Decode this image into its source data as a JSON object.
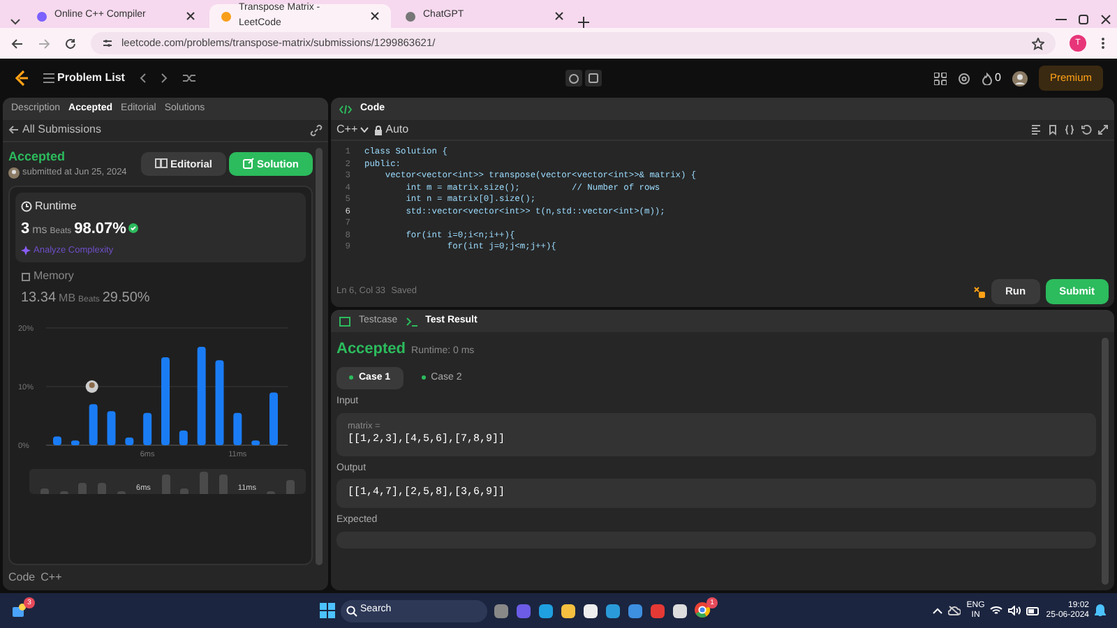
{
  "browser": {
    "tabs": [
      {
        "title": "Online C++ Compiler",
        "selected": false
      },
      {
        "title": "Transpose Matrix - LeetCode",
        "selected": true
      },
      {
        "title": "ChatGPT",
        "selected": false
      }
    ],
    "url": "leetcode.com/problems/transpose-matrix/submissions/1299863621/",
    "profile_initial": "T"
  },
  "header": {
    "problem_list": "Problem List",
    "streak": "0",
    "premium": "Premium"
  },
  "left_panel": {
    "tabs": [
      {
        "label": "Description",
        "selected": false
      },
      {
        "label": "Accepted",
        "selected": true
      },
      {
        "label": "Editorial",
        "selected": false
      },
      {
        "label": "Solutions",
        "selected": false
      }
    ],
    "back_link": "All Submissions",
    "status": "Accepted",
    "submitted": "submitted at Jun 25, 2024",
    "editorial_button": "Editorial",
    "solution_button": "Solution",
    "runtime": {
      "label": "Runtime",
      "value": "3",
      "unit": "ms",
      "beats_label": "Beats",
      "beats": "98.07%",
      "analyze": "Analyze Complexity"
    },
    "memory": {
      "label": "Memory",
      "value": "13.34",
      "unit": "MB",
      "beats_label": "Beats",
      "beats": "29.50%"
    },
    "chart_data": {
      "type": "bar",
      "x": [
        1,
        2,
        3,
        4,
        5,
        6,
        7,
        8,
        9,
        10,
        11,
        12,
        13
      ],
      "xlim": [
        1,
        13
      ],
      "series": [
        {
          "color": "#1a7cf5",
          "values": [
            1.5,
            0.8,
            7,
            5.8,
            1.3,
            5.5,
            15,
            2.5,
            16.8,
            14.5,
            5.5,
            0.8,
            9
          ]
        }
      ],
      "ylim": [
        0,
        20
      ],
      "yticks": [
        {
          "value": 0,
          "label": "0%"
        },
        {
          "value": 10,
          "label": "10%"
        },
        {
          "value": 20,
          "label": "20%"
        }
      ],
      "xticks": [
        {
          "value": 6,
          "label": "6ms"
        },
        {
          "value": 11,
          "label": "11ms"
        }
      ]
    },
    "navigator_labels": [
      "6ms",
      "11ms"
    ],
    "footer": [
      "Code",
      "C++"
    ]
  },
  "code_panel": {
    "title": "Code",
    "language": "C++",
    "mode": "Auto",
    "lines": [
      {
        "number": "1",
        "text": "class Solution {",
        "current": false
      },
      {
        "number": "2",
        "text": "public:",
        "current": false
      },
      {
        "number": "3",
        "text": "    vector<vector<int>> transpose(vector<vector<int>>& matrix) {",
        "current": false
      },
      {
        "number": "4",
        "text": "        int m = matrix.size();          // Number of rows",
        "current": false
      },
      {
        "number": "5",
        "text": "        int n = matrix[0].size();",
        "current": false
      },
      {
        "number": "6",
        "text": "        std::vector<vector<int>> t(n,std::vector<int>(m));",
        "current": true
      },
      {
        "number": "7",
        "current": false
      },
      {
        "number": "8",
        "text": "        for(int i=0;i<n;i++){",
        "current": false
      },
      {
        "number": "9",
        "text": "                for(int j=0;j<m;j++){",
        "current": false
      }
    ],
    "cursor": "Ln 6, Col 33",
    "save_state": "Saved",
    "run_button": "Run",
    "submit_button": "Submit"
  },
  "test_panel": {
    "tabs": [
      {
        "label": "Testcase",
        "selected": false
      },
      {
        "label": "Test Result",
        "selected": true
      }
    ],
    "result": "Accepted",
    "runtime": "Runtime: 0 ms",
    "cases": [
      {
        "label": "Case 1",
        "selected": true
      },
      {
        "label": "Case 2",
        "selected": false
      }
    ],
    "sections": [
      {
        "label": "Input",
        "param": "matrix =",
        "value": "[[1,2,3],[4,5,6],[7,8,9]]"
      },
      {
        "label": "Output",
        "value": "[[1,4,7],[2,5,8],[3,6,9]]"
      },
      {
        "label": "Expected"
      }
    ]
  },
  "taskbar": {
    "widget_badge": "3",
    "search": "Search",
    "chrome_badge": "1",
    "language": "ENG",
    "region": "IN",
    "time": "19:02",
    "date": "25-06-2024"
  }
}
